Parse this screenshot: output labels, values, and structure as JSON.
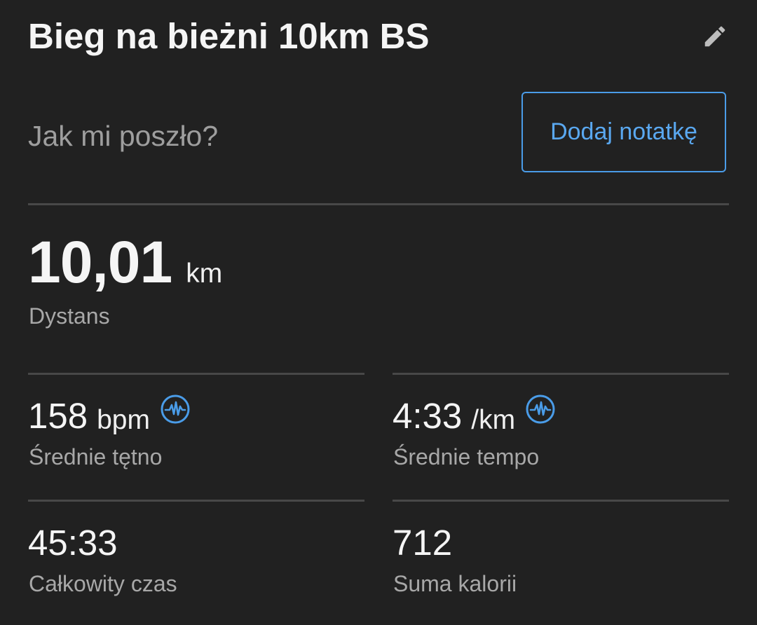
{
  "header": {
    "title": "Bieg na bieżni 10km BS",
    "edit_icon": "pencil-icon"
  },
  "feedback": {
    "question": "Jak mi poszło?",
    "add_note_label": "Dodaj notatkę"
  },
  "distance": {
    "value": "10,01",
    "unit": "km",
    "label": "Dystans"
  },
  "stats": {
    "heart_rate": {
      "value": "158",
      "unit": "bpm",
      "label": "Średnie tętno",
      "icon": "heart-rate-icon"
    },
    "pace": {
      "value": "4:33",
      "unit": "/km",
      "label": "Średnie tempo",
      "icon": "heart-rate-icon"
    },
    "total_time": {
      "value": "45:33",
      "label": "Całkowity czas"
    },
    "calories": {
      "value": "712",
      "label": "Suma kalorii"
    }
  },
  "colors": {
    "background": "#212121",
    "accent": "#4a9ce8",
    "divider": "#484848"
  }
}
